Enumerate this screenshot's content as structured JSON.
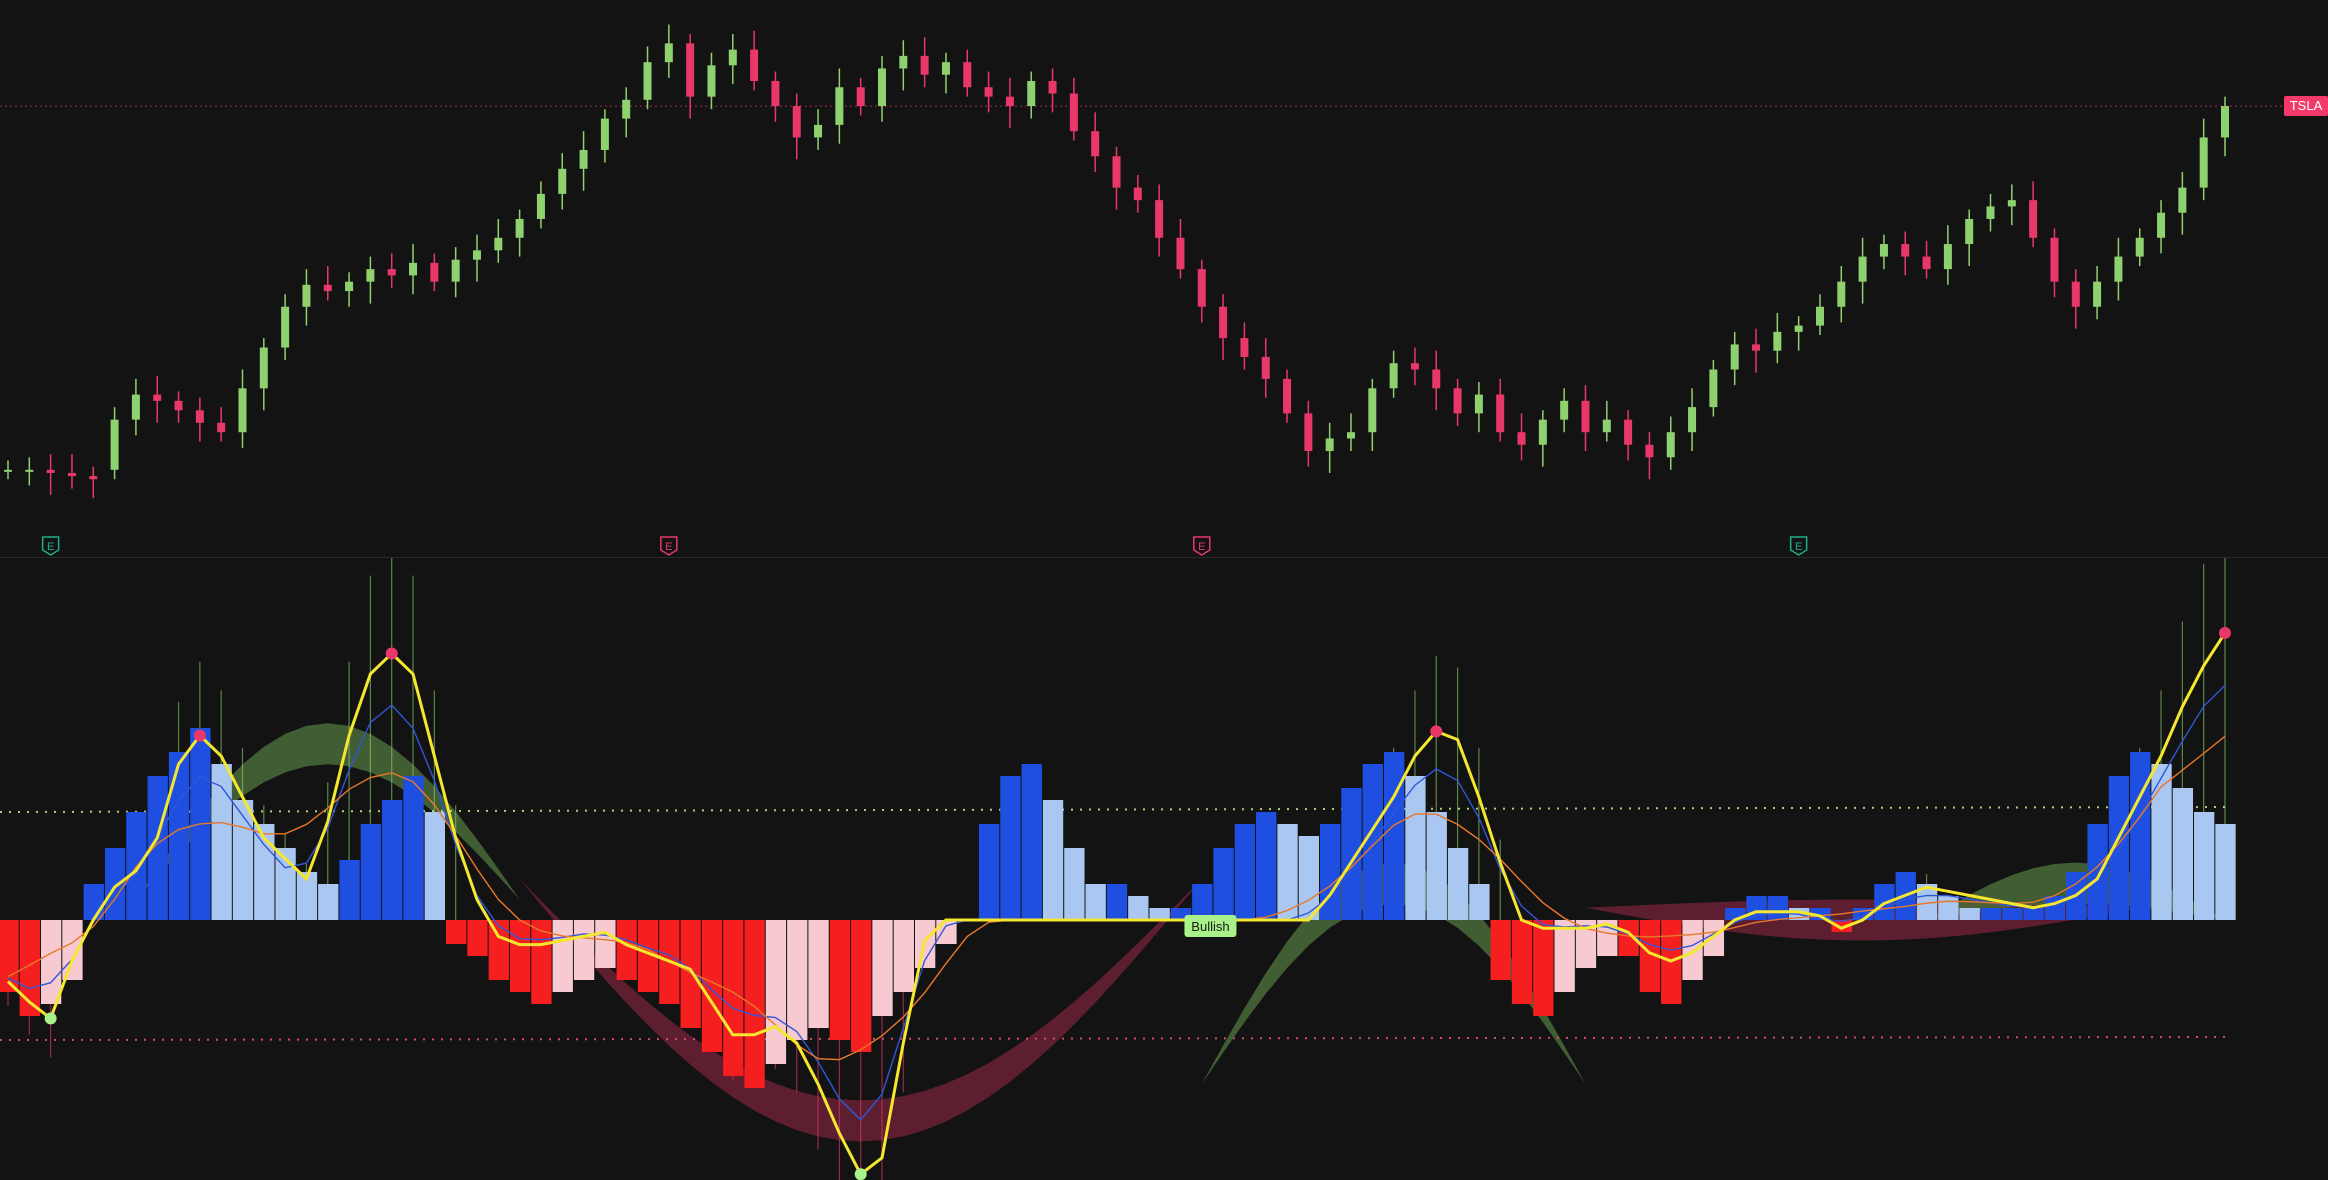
{
  "ticker": {
    "label": "TSLA",
    "color": "#f23a6a"
  },
  "colors": {
    "background": "#131313",
    "up_candle": "#8fd16f",
    "down_candle": "#e8386a",
    "hist_pos_strong": "#1e4fe0",
    "hist_pos_weak": "#a9c7f0",
    "hist_neg_strong": "#f51f1f",
    "hist_neg_weak": "#f7c9d0",
    "osc_line": "#f5e72e",
    "fast_line": "#2f57d8",
    "slow_line": "#e8772a",
    "band_bull": "#4a6b3a",
    "band_bear": "#6b2236",
    "upper_level": "#a9d17a",
    "lower_level": "#d94a6a"
  },
  "earnings_markers": [
    {
      "label": "E",
      "type": "positive",
      "bar": 2
    },
    {
      "label": "E",
      "type": "negative",
      "bar": 31
    },
    {
      "label": "E",
      "type": "negative",
      "bar": 56
    },
    {
      "label": "E",
      "type": "positive",
      "bar": 84
    }
  ],
  "signal_label": {
    "text": "Bullish",
    "bar": 55
  },
  "chart_data": [
    {
      "type": "candlestick",
      "title": "",
      "series_name": "TSLA",
      "bars": 105,
      "close": [
        206,
        206,
        205,
        204,
        203,
        222,
        230,
        228,
        225,
        221,
        218,
        232,
        245,
        258,
        265,
        263,
        266,
        270,
        268,
        272,
        266,
        273,
        276,
        280,
        286,
        294,
        302,
        308,
        318,
        324,
        336,
        342,
        325,
        335,
        340,
        330,
        322,
        312,
        316,
        328,
        322,
        334,
        338,
        332,
        336,
        328,
        325,
        322,
        330,
        326,
        314,
        306,
        296,
        292,
        280,
        270,
        258,
        248,
        242,
        235,
        224,
        212,
        216,
        218,
        232,
        240,
        238,
        232,
        224,
        230,
        218,
        214,
        222,
        228,
        218,
        222,
        214,
        210,
        218,
        226,
        238,
        246,
        244,
        250,
        252,
        258,
        266,
        274,
        278,
        274,
        270,
        278,
        286,
        290,
        292,
        280,
        266,
        258,
        266,
        274,
        280,
        288,
        296,
        312,
        322
      ],
      "open": [
        206,
        206,
        206,
        205,
        204,
        206,
        222,
        230,
        228,
        225,
        221,
        218,
        232,
        245,
        258,
        265,
        263,
        266,
        270,
        268,
        272,
        266,
        273,
        276,
        280,
        286,
        294,
        302,
        308,
        318,
        324,
        336,
        342,
        325,
        335,
        340,
        330,
        322,
        312,
        316,
        328,
        322,
        334,
        338,
        332,
        336,
        328,
        325,
        322,
        330,
        326,
        314,
        306,
        296,
        292,
        280,
        270,
        258,
        248,
        242,
        235,
        224,
        212,
        216,
        218,
        232,
        240,
        238,
        232,
        224,
        230,
        218,
        214,
        222,
        228,
        218,
        222,
        214,
        210,
        218,
        226,
        238,
        246,
        244,
        250,
        252,
        258,
        266,
        274,
        278,
        274,
        270,
        278,
        286,
        290,
        292,
        280,
        266,
        258,
        266,
        274,
        280,
        288,
        296,
        312
      ],
      "high_low_note": "",
      "ref_line_price": 322
    },
    {
      "type": "oscillator",
      "title": "",
      "upper_level": 30,
      "lower_level": -30,
      "osc": [
        -15,
        -20,
        -24,
        -10,
        0,
        8,
        12,
        20,
        38,
        45,
        40,
        30,
        20,
        15,
        10,
        24,
        45,
        60,
        65,
        60,
        40,
        20,
        5,
        -4,
        -6,
        -6,
        -5,
        -4,
        -3,
        -6,
        -8,
        -10,
        -12,
        -20,
        -28,
        -28,
        -26,
        -30,
        -40,
        -52,
        -62,
        -58,
        -30,
        -5,
        0,
        0,
        0,
        0,
        0,
        0,
        0,
        0,
        0,
        0,
        0,
        0,
        0,
        0,
        0,
        0,
        0,
        0,
        6,
        14,
        22,
        30,
        40,
        46,
        44,
        30,
        14,
        0,
        -2,
        -2,
        -2,
        -1,
        -3,
        -8,
        -10,
        -8,
        -4,
        0,
        2,
        2,
        2,
        1,
        -2,
        0,
        4,
        6,
        8,
        7,
        6,
        5,
        4,
        3,
        4,
        6,
        10,
        20,
        30,
        40,
        52,
        62,
        70
      ],
      "hist": [
        -6,
        -8,
        -7,
        -5,
        3,
        6,
        9,
        12,
        14,
        16,
        13,
        10,
        8,
        6,
        4,
        3,
        5,
        8,
        10,
        12,
        9,
        -2,
        -3,
        -5,
        -6,
        -7,
        -6,
        -5,
        -4,
        -5,
        -6,
        -7,
        -9,
        -11,
        -13,
        -14,
        -12,
        -10,
        -9,
        -10,
        -11,
        -8,
        -6,
        -4,
        -2,
        0,
        8,
        12,
        13,
        10,
        6,
        3,
        3,
        2,
        1,
        1,
        3,
        6,
        8,
        9,
        8,
        7,
        8,
        11,
        13,
        14,
        12,
        9,
        6,
        3,
        -5,
        -7,
        -8,
        -6,
        -4,
        -3,
        -3,
        -6,
        -7,
        -5,
        -3,
        1,
        2,
        2,
        1,
        1,
        -1,
        1,
        3,
        4,
        3,
        2,
        1,
        1,
        1,
        1,
        2,
        4,
        8,
        12,
        14,
        13,
        11,
        9,
        8
      ],
      "trend_band_note": ""
    }
  ]
}
